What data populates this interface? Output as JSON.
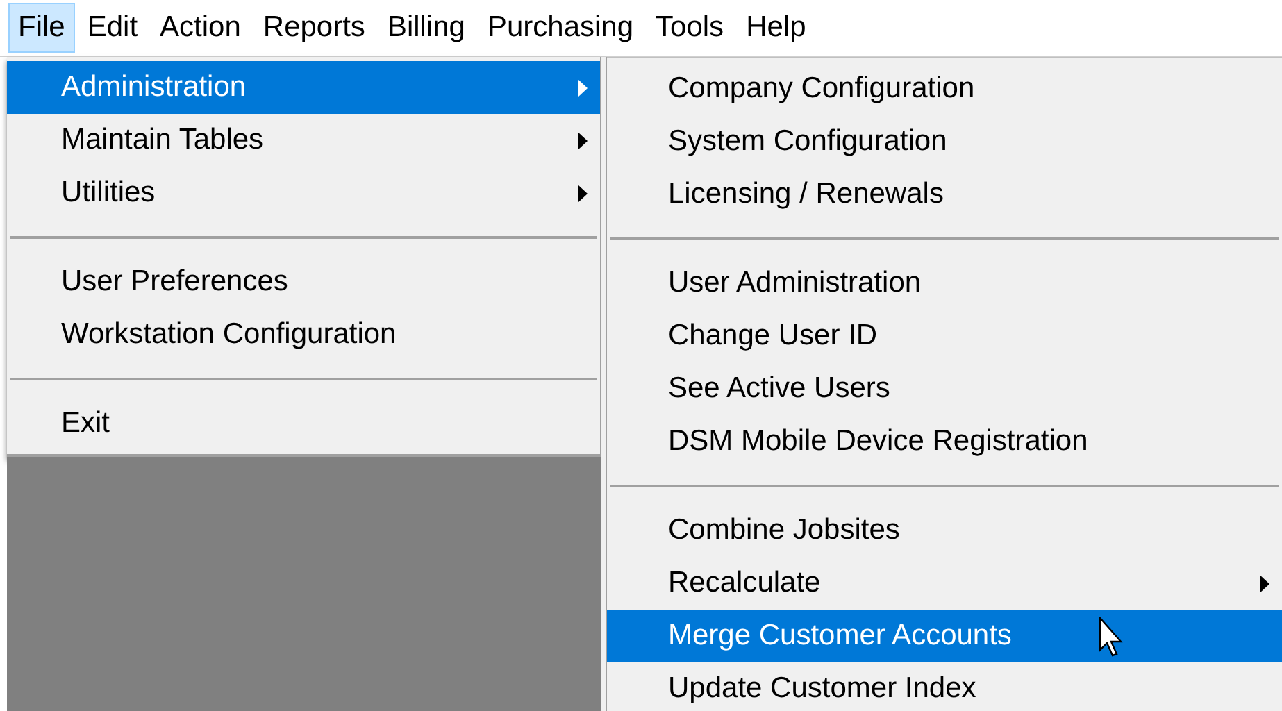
{
  "menubar": [
    {
      "label": "File",
      "selected": true
    },
    {
      "label": "Edit",
      "selected": false
    },
    {
      "label": "Action",
      "selected": false
    },
    {
      "label": "Reports",
      "selected": false
    },
    {
      "label": "Billing",
      "selected": false
    },
    {
      "label": "Purchasing",
      "selected": false
    },
    {
      "label": "Tools",
      "selected": false
    },
    {
      "label": "Help",
      "selected": false
    }
  ],
  "file_menu": [
    {
      "kind": "item",
      "label": "Administration",
      "submenu": true,
      "selected": true
    },
    {
      "kind": "item",
      "label": "Maintain Tables",
      "submenu": true,
      "selected": false
    },
    {
      "kind": "item",
      "label": "Utilities",
      "submenu": true,
      "selected": false
    },
    {
      "kind": "separator"
    },
    {
      "kind": "item",
      "label": "User Preferences",
      "submenu": false,
      "selected": false
    },
    {
      "kind": "item",
      "label": "Workstation Configuration",
      "submenu": false,
      "selected": false
    },
    {
      "kind": "separator"
    },
    {
      "kind": "item",
      "label": "Exit",
      "submenu": false,
      "selected": false
    }
  ],
  "administration_menu": [
    {
      "kind": "item",
      "label": "Company Configuration",
      "submenu": false,
      "selected": false
    },
    {
      "kind": "item",
      "label": "System Configuration",
      "submenu": false,
      "selected": false
    },
    {
      "kind": "item",
      "label": "Licensing / Renewals",
      "submenu": false,
      "selected": false
    },
    {
      "kind": "separator"
    },
    {
      "kind": "item",
      "label": "User Administration",
      "submenu": false,
      "selected": false
    },
    {
      "kind": "item",
      "label": "Change User ID",
      "submenu": false,
      "selected": false
    },
    {
      "kind": "item",
      "label": "See Active Users",
      "submenu": false,
      "selected": false
    },
    {
      "kind": "item",
      "label": "DSM Mobile Device Registration",
      "submenu": false,
      "selected": false
    },
    {
      "kind": "separator"
    },
    {
      "kind": "item",
      "label": "Combine Jobsites",
      "submenu": false,
      "selected": false
    },
    {
      "kind": "item",
      "label": "Recalculate",
      "submenu": true,
      "selected": false
    },
    {
      "kind": "item",
      "label": "Merge Customer Accounts",
      "submenu": false,
      "selected": true
    },
    {
      "kind": "item",
      "label": "Update Customer Index",
      "submenu": false,
      "selected": false
    }
  ]
}
